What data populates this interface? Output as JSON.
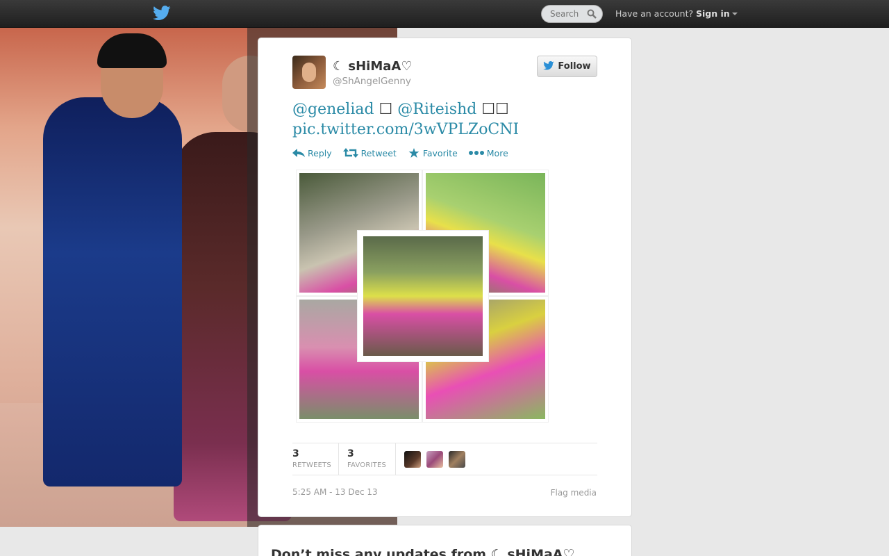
{
  "topbar": {
    "logo_icon": "twitter-bird-icon",
    "search_placeholder": "Search",
    "have_account": "Have an account?",
    "sign_in": "Sign in"
  },
  "tweet": {
    "fullname": "☾ sHiMaA♡",
    "username": "@ShAngelGenny",
    "follow_label": "Follow",
    "text": {
      "mention1": "@geneliad",
      "box1": " ☐ ",
      "mention2": "@Riteishd",
      "box2": " ☐☐",
      "link": "pic.twitter.com/3wVPLZoCNI"
    },
    "actions": {
      "reply": "Reply",
      "retweet": "Retweet",
      "favorite": "Favorite",
      "more": "More"
    },
    "stats": {
      "retweets_count": "3",
      "retweets_label": "RETWEETS",
      "favorites_count": "3",
      "favorites_label": "FAVORITES"
    },
    "timestamp": "5:25 AM - 13 Dec 13",
    "flag_media": "Flag media"
  },
  "signup": {
    "headline": "Don’t miss any updates from ☾ sHiMaA♡"
  },
  "colors": {
    "link": "#2a8aa6",
    "topbar": "#2b2b2b",
    "page_bg": "#e8e8e8",
    "twitter_blue": "#55acee"
  }
}
